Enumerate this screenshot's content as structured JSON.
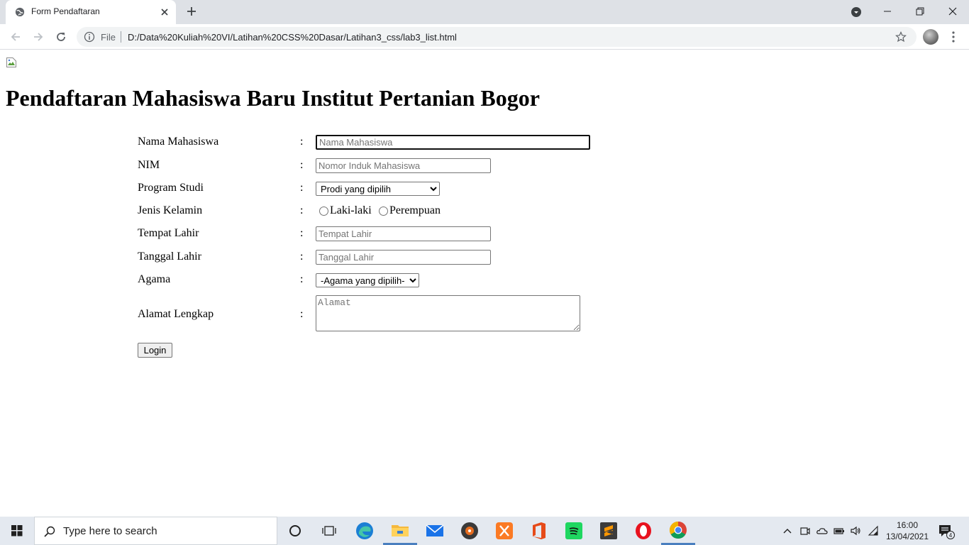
{
  "browser": {
    "tab_title": "Form Pendaftaran",
    "omnibox": {
      "scheme_label": "File",
      "url": "D:/Data%20Kuliah%20VI/Latihan%20CSS%20Dasar/Latihan3_css/lab3_list.html"
    }
  },
  "page": {
    "title": "Pendaftaran Mahasiswa Baru Institut Pertanian Bogor",
    "form": {
      "nama": {
        "label": "Nama Mahasiswa",
        "colon": ":",
        "placeholder": "Nama Mahasiswa"
      },
      "nim": {
        "label": "NIM",
        "colon": ":",
        "placeholder": "Nomor Induk Mahasiswa"
      },
      "prodi": {
        "label": "Program Studi",
        "colon": ":",
        "selected": "Prodi yang dipilih"
      },
      "gender": {
        "label": "Jenis Kelamin",
        "colon": ":",
        "options": [
          "Laki-laki",
          "Perempuan"
        ]
      },
      "tempat": {
        "label": "Tempat Lahir",
        "colon": ":",
        "placeholder": "Tempat Lahir"
      },
      "tanggal": {
        "label": "Tanggal Lahir",
        "colon": ":",
        "placeholder": "Tanggal Lahir"
      },
      "agama": {
        "label": "Agama",
        "colon": ":",
        "selected": "-Agama yang dipilih-"
      },
      "alamat": {
        "label": "Alamat Lengkap",
        "colon": ":",
        "placeholder": "Alamat"
      },
      "submit_label": "Login"
    }
  },
  "taskbar": {
    "search_placeholder": "Type here to search",
    "time": "16:00",
    "date": "13/04/2021",
    "notification_count": "4",
    "apps": [
      "task-view-icon",
      "edge-icon",
      "file-explorer-icon",
      "mail-icon",
      "media-player-icon",
      "xampp-icon",
      "office-icon",
      "spotify-icon",
      "sublime-text-icon",
      "opera-icon",
      "chrome-icon"
    ]
  },
  "colors": {
    "tabstrip": "#dee1e6",
    "omnibox": "#f1f3f4",
    "taskbar": "#e4e9f0",
    "taskbar_active": "#4a7fbf"
  }
}
